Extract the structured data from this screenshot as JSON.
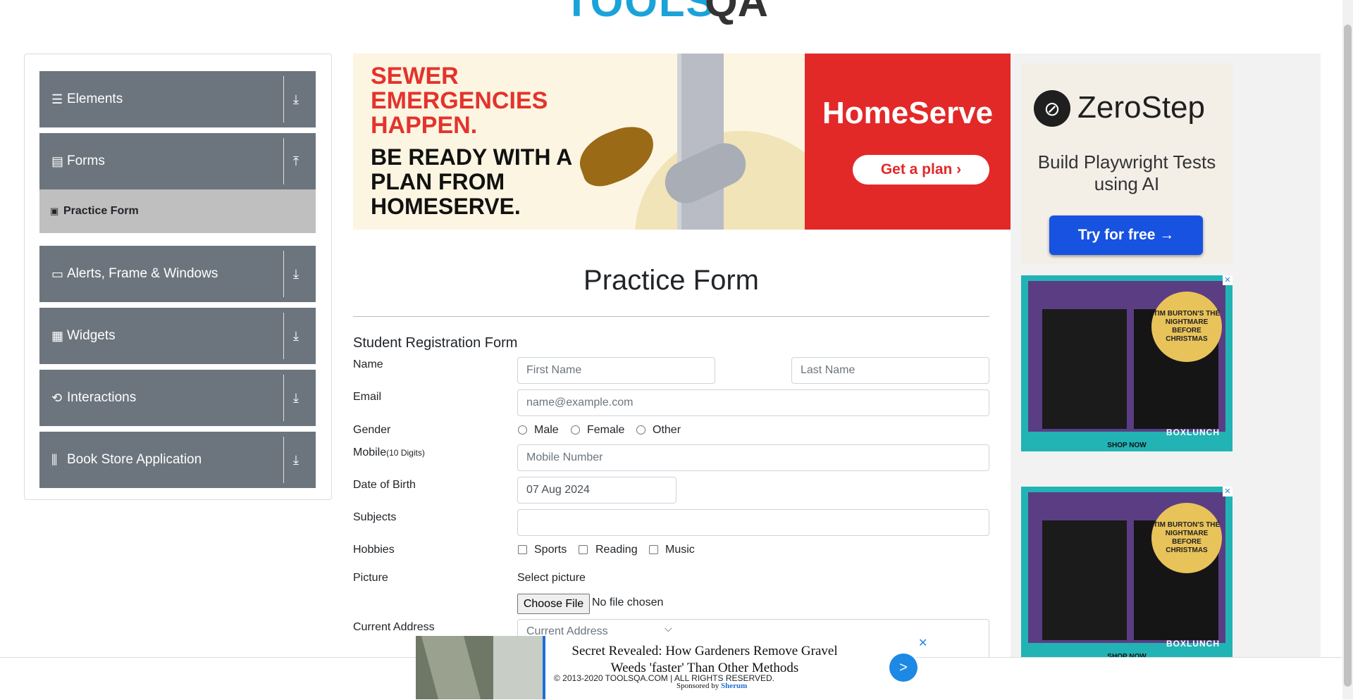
{
  "logo": {
    "text": "TOOLS",
    "qa": "QA"
  },
  "sidebar": {
    "groups": [
      {
        "label": "Elements",
        "icon": "menu-icon"
      },
      {
        "label": "Forms",
        "icon": "document-icon"
      },
      {
        "label": "Alerts, Frame & Windows",
        "icon": "window-icon"
      },
      {
        "label": "Widgets",
        "icon": "widgets-icon"
      },
      {
        "label": "Interactions",
        "icon": "interactions-icon"
      },
      {
        "label": "Book Store Application",
        "icon": "books-icon"
      }
    ],
    "active_sub": "Practice Form"
  },
  "banner": {
    "headline": "SEWER EMERGENCIES HAPPEN.",
    "body": "BE READY WITH A PLAN FROM HOMESERVE.",
    "brand": "HomeServe",
    "cta": "Get a plan ›"
  },
  "zerostep": {
    "brand": "ZeroStep",
    "tagline": "Build Playwright Tests using AI",
    "cta": "Try for free →"
  },
  "side_ad": {
    "badge": "TIM BURTON'S THE NIGHTMARE BEFORE CHRISTMAS",
    "brand": "BOXLUNCH",
    "shop": "SHOP NOW"
  },
  "form": {
    "title": "Practice Form",
    "subtitle": "Student Registration Form",
    "name_label": "Name",
    "first_name_placeholder": "First Name",
    "last_name_placeholder": "Last Name",
    "email_label": "Email",
    "email_placeholder": "name@example.com",
    "gender_label": "Gender",
    "genders": [
      "Male",
      "Female",
      "Other"
    ],
    "mobile_label": "Mobile",
    "mobile_hint": "(10 Digits)",
    "mobile_placeholder": "Mobile Number",
    "dob_label": "Date of Birth",
    "dob_value": "07 Aug 2024",
    "subjects_label": "Subjects",
    "hobbies_label": "Hobbies",
    "hobbies": [
      "Sports",
      "Reading",
      "Music"
    ],
    "picture_label": "Picture",
    "select_picture": "Select picture",
    "choose_file": "Choose File",
    "no_file": "No file chosen",
    "address_label": "Current Address",
    "address_placeholder": "Current Address"
  },
  "bottom_ad": {
    "headline": "Secret Revealed: How Gardeners Remove Gravel Weeds 'faster' Than Other Methods",
    "sponsored": "Sponsored by",
    "sponsor": "Sherum",
    "go": ">",
    "close": "✕"
  },
  "footer": {
    "copyright": "© 2013-2020 TOOLSQA.COM | ALL RIGHTS RESERVED."
  }
}
